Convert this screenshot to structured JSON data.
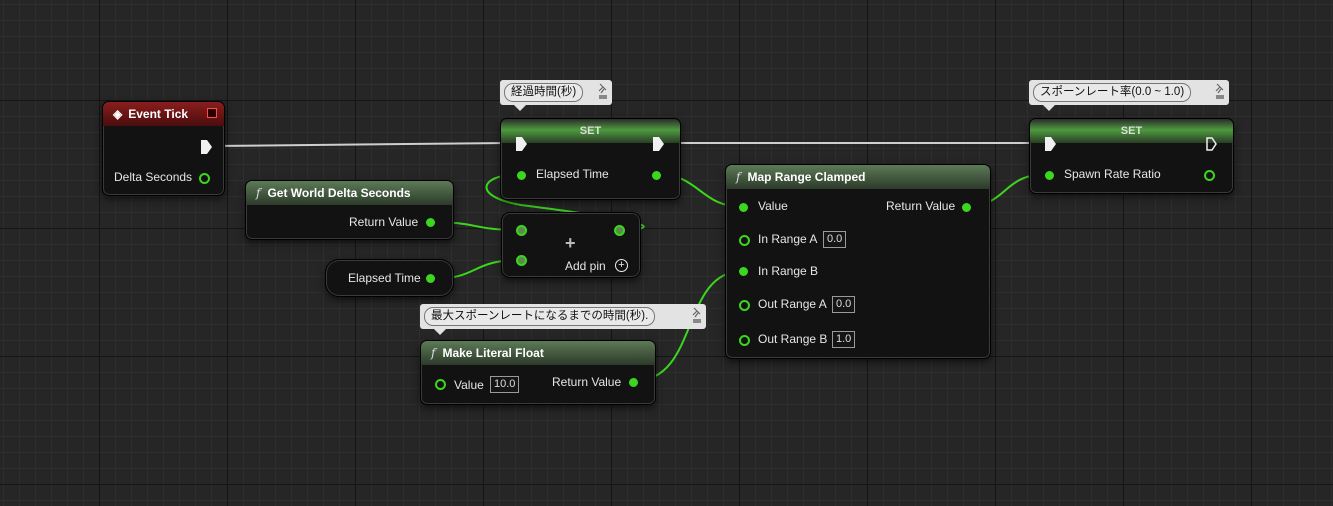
{
  "event_tick": {
    "title": "Event Tick",
    "delta_seconds": "Delta Seconds"
  },
  "set_elapsed": {
    "title": "SET",
    "pin": "Elapsed Time",
    "comment": "経過時間(秒)"
  },
  "set_spawn": {
    "title": "SET",
    "pin": "Spawn Rate Ratio",
    "comment": "スポーンレート率(0.0 ~ 1.0)"
  },
  "get_world_delta": {
    "title": "Get World Delta Seconds",
    "return": "Return Value"
  },
  "add_node": {
    "add_pin": "Add pin",
    "plus": "+"
  },
  "elapsed_getter": {
    "label": "Elapsed Time"
  },
  "make_literal": {
    "title": "Make Literal Float",
    "comment": "最大スポーンレートになるまでの時間(秒).",
    "value_label": "Value",
    "value": "10.0",
    "return": "Return Value"
  },
  "map_range": {
    "title": "Map Range Clamped",
    "value": "Value",
    "return": "Return Value",
    "in_a": "In Range A",
    "in_a_val": "0.0",
    "in_b": "In Range B",
    "out_a": "Out Range A",
    "out_a_val": "0.0",
    "out_b": "Out Range B",
    "out_b_val": "1.0"
  },
  "colors": {
    "float_pin": "#3cd61e",
    "exec_wire": "#d0d0d0",
    "event_header": "#8a1e1e",
    "func_header": "#5c7a56"
  }
}
